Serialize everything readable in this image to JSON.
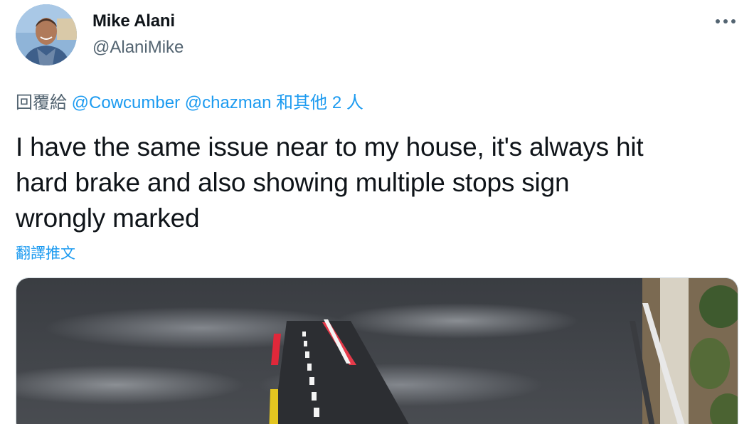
{
  "author": {
    "display_name": "Mike Alani",
    "handle": "@AlaniMike"
  },
  "reply_context": {
    "prefix": "回覆給",
    "mentions": [
      "@Cowcumber",
      "@chazman"
    ],
    "suffix": "和其他 2 人"
  },
  "tweet": {
    "text_lines": [
      "I have the same issue near to my house, it's always hit",
      "hard brake and also showing multiple stops sign",
      "wrongly marked"
    ],
    "translate_label": "翻譯推文"
  },
  "icons": {
    "more": "more-horizontal-icon"
  },
  "colors": {
    "link": "#1d9bf0",
    "secondary_text": "#536471",
    "primary_text": "#0f1419"
  }
}
